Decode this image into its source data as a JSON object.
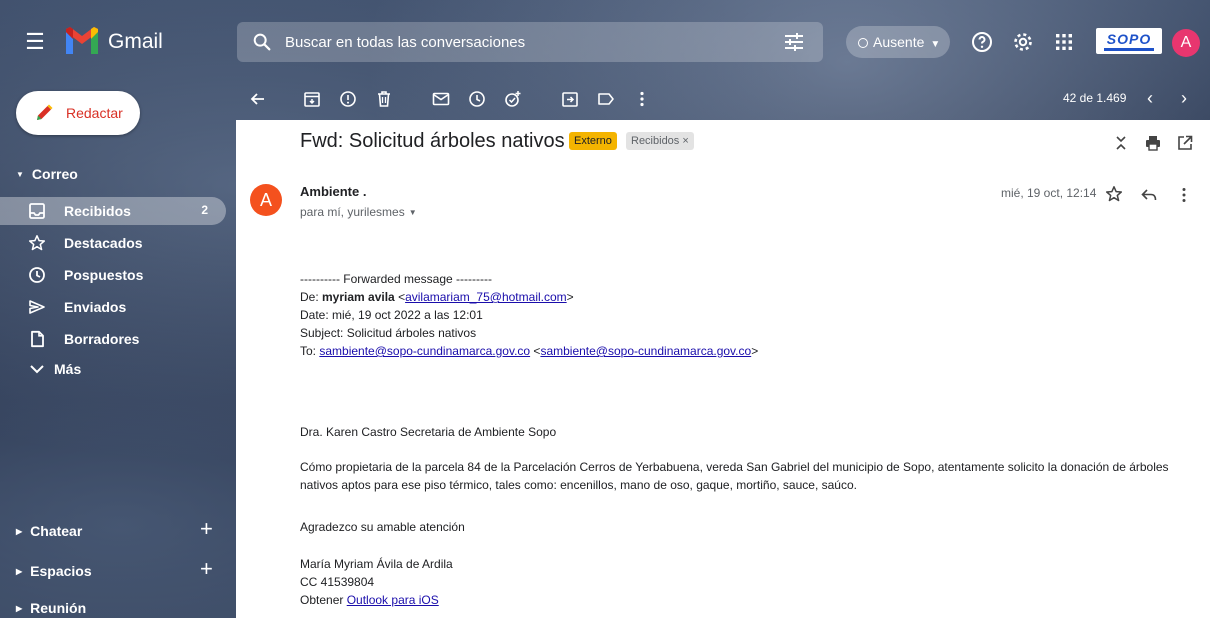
{
  "header": {
    "brand": "Gmail",
    "search_placeholder": "Buscar en todas las conversaciones",
    "status": "Ausente",
    "avatar_letter": "A",
    "org_logo_text": "SOPO"
  },
  "compose": {
    "label": "Redactar"
  },
  "sidebar": {
    "mail_section": "Correo",
    "items": [
      {
        "label": "Recibidos",
        "count": "2",
        "icon": "inbox-icon"
      },
      {
        "label": "Destacados",
        "icon": "star-icon"
      },
      {
        "label": "Pospuestos",
        "icon": "clock-icon"
      },
      {
        "label": "Enviados",
        "icon": "send-icon"
      },
      {
        "label": "Borradores",
        "icon": "draft-icon"
      },
      {
        "label": "Más",
        "icon": "chevron-down-icon"
      }
    ],
    "chat_section": "Chatear",
    "spaces_section": "Espacios",
    "meet_section": "Reunión"
  },
  "toolbar": {
    "pager": "42 de 1.469"
  },
  "email": {
    "subject": "Fwd: Solicitud árboles nativos",
    "labels": {
      "external": "Externo",
      "inbox": "Recibidos ×"
    },
    "sender": "Ambiente .",
    "sender_initial": "A",
    "recipients": "para mí, yurilesmes",
    "date": "mié, 19 oct, 12:14",
    "body": {
      "fwd_header": "---------- Forwarded message ---------",
      "from_label": "De: ",
      "from_name": "myriam avila",
      "from_email_open": " <",
      "from_email": "avilamariam_75@hotmail.com",
      "from_email_close": ">",
      "date_line": "Date: mié, 19 oct 2022 a las 12:01",
      "subject_line": "Subject: Solicitud árboles nativos",
      "to_label": "To: ",
      "to_email1": "sambiente@sopo-cundinamarca.gov.co",
      "to_sep": " <",
      "to_email2": "sambiente@sopo-cundinamarca.gov.co",
      "to_close": ">",
      "greeting": "Dra. Karen Castro Secretaria de Ambiente Sopo",
      "paragraph": "Cómo propietaria de la parcela 84 de la Parcelación Cerros de Yerbabuena, vereda San Gabriel del municipio de Sopo, atentamente solicito la donación de árboles nativos aptos para ese piso térmico, tales como: encenillos, mano de oso, gaque, mortiño, sauce, saúco.",
      "thanks": "Agradezco su amable atención",
      "signature_name": "María Myriam Ávila de Ardila",
      "signature_id": "CC 41539804",
      "outlook_prefix": "Obtener ",
      "outlook_link": "Outlook para iOS"
    }
  }
}
